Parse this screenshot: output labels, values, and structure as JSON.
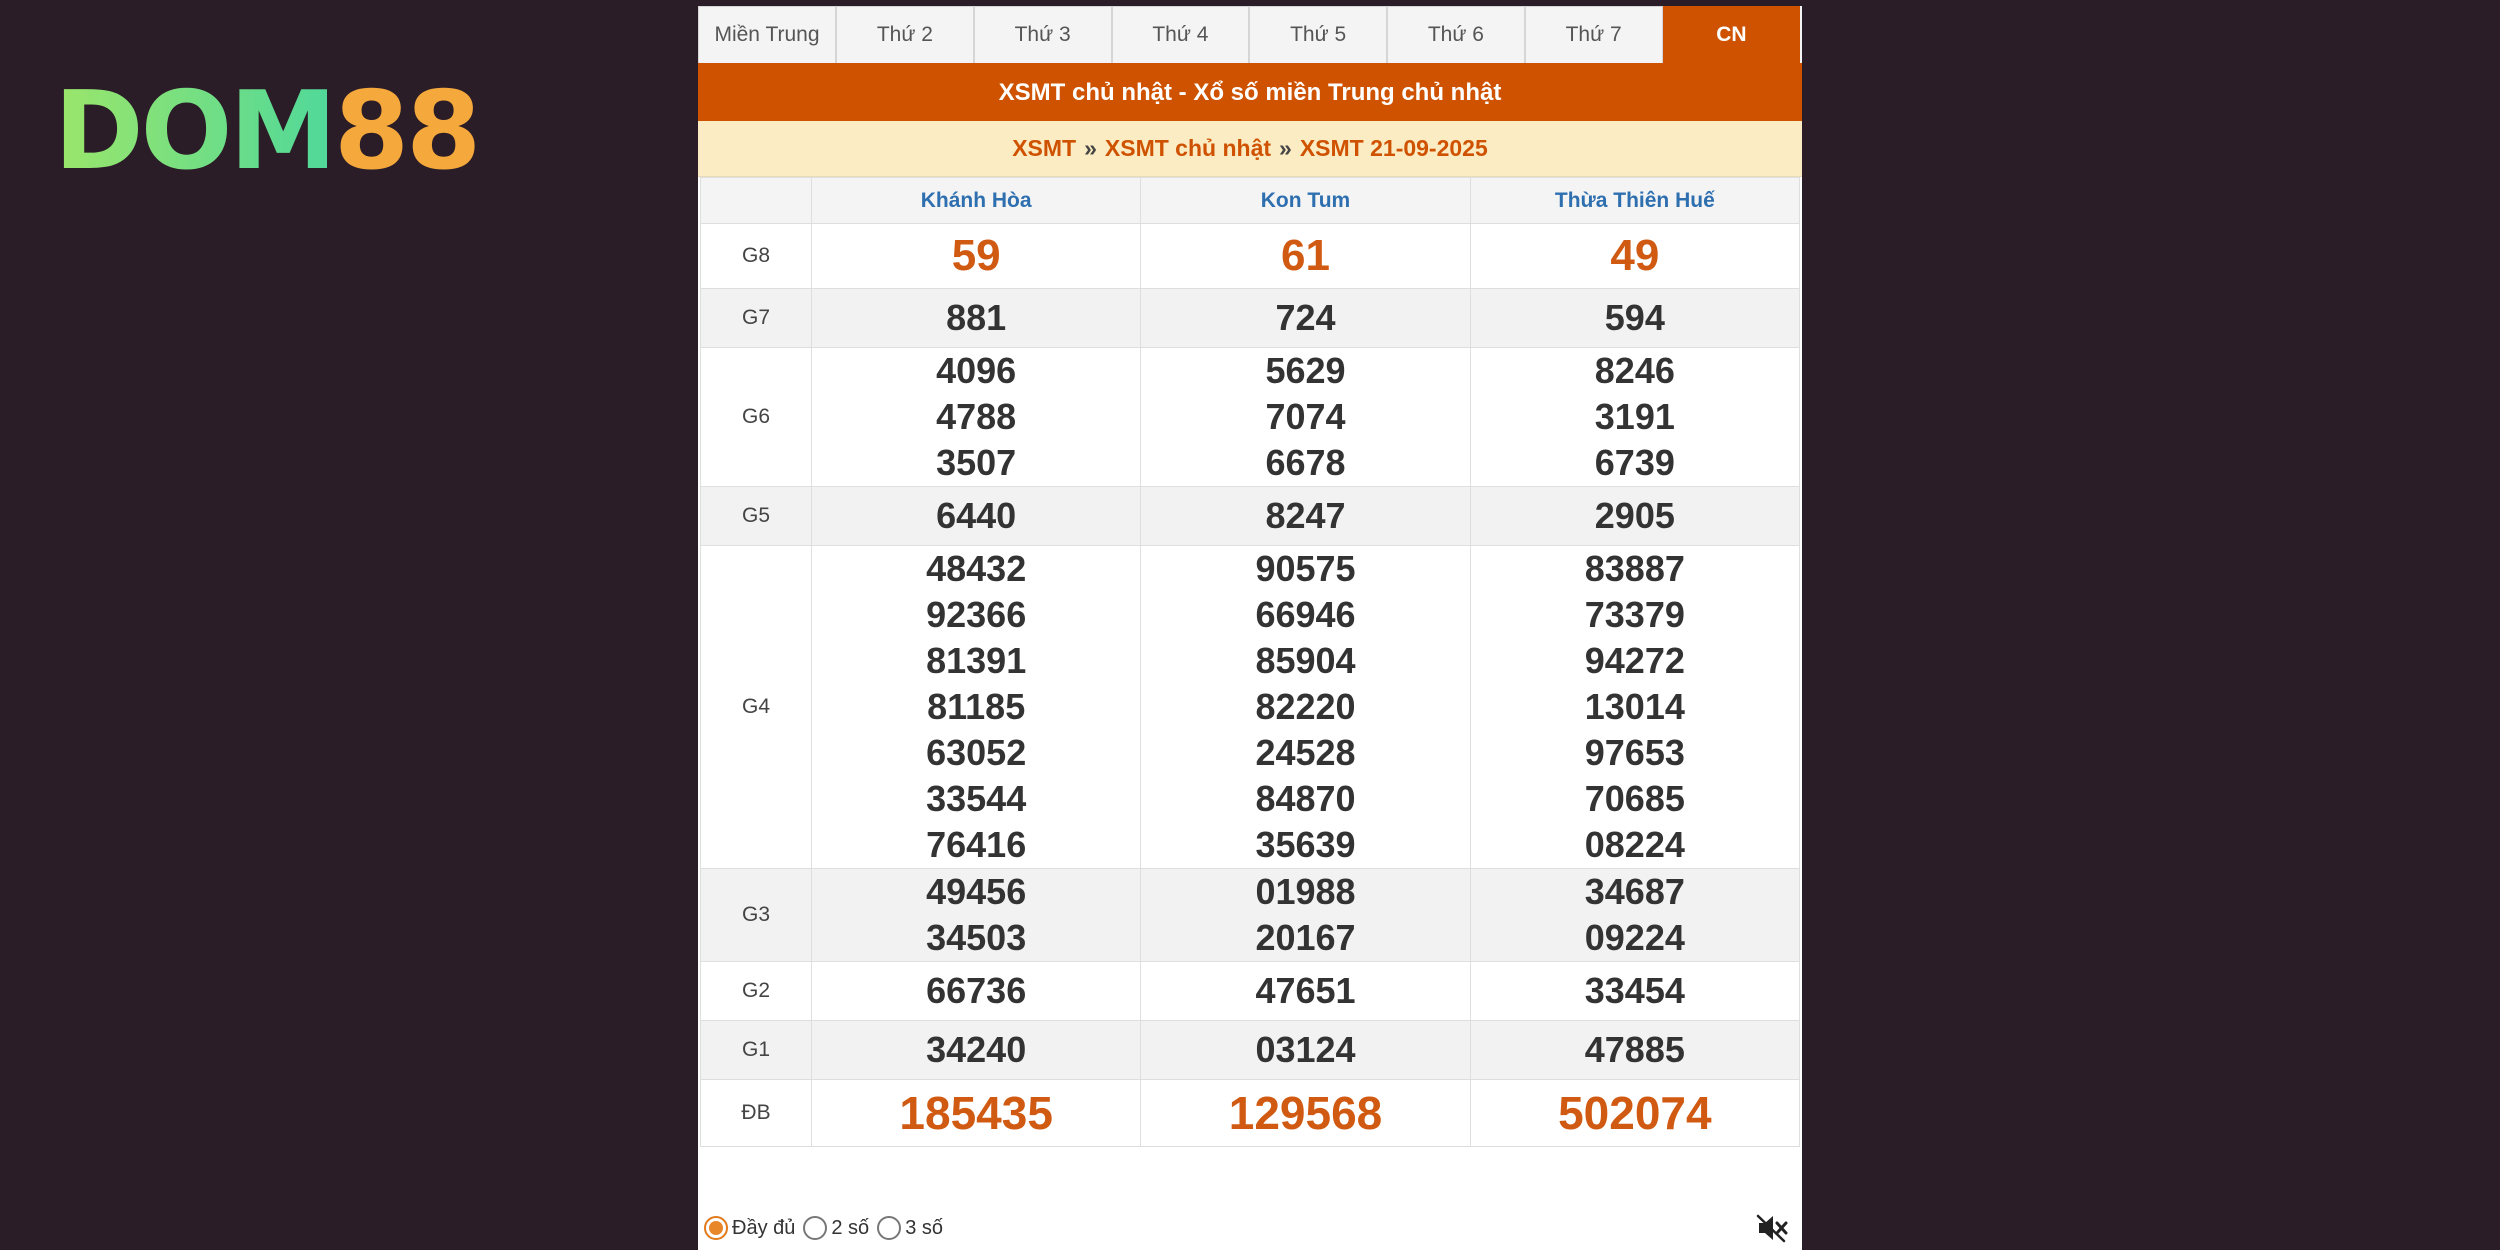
{
  "logo": {
    "part1": "DOM",
    "part2": "88"
  },
  "tabs": [
    "Miền Trung",
    "Thứ 2",
    "Thứ 3",
    "Thứ 4",
    "Thứ 5",
    "Thứ 6",
    "Thứ 7",
    "CN"
  ],
  "active_tab": "CN",
  "title": "XSMT chủ nhật - Xổ số miền Trung chủ nhật",
  "breadcrumb": {
    "b1": "XSMT",
    "sep": "»",
    "b2": "XSMT chủ nhật",
    "b3": "XSMT 21-09-2025"
  },
  "columns": [
    "Khánh Hòa",
    "Kon Tum",
    "Thừa Thiên Huế"
  ],
  "prizes": [
    {
      "label": "G8",
      "values": [
        [
          "59"
        ],
        [
          "61"
        ],
        [
          "49"
        ]
      ]
    },
    {
      "label": "G7",
      "values": [
        [
          "881"
        ],
        [
          "724"
        ],
        [
          "594"
        ]
      ]
    },
    {
      "label": "G6",
      "values": [
        [
          "4096",
          "4788",
          "3507"
        ],
        [
          "5629",
          "7074",
          "6678"
        ],
        [
          "8246",
          "3191",
          "6739"
        ]
      ]
    },
    {
      "label": "G5",
      "values": [
        [
          "6440"
        ],
        [
          "8247"
        ],
        [
          "2905"
        ]
      ]
    },
    {
      "label": "G4",
      "values": [
        [
          "48432",
          "92366",
          "81391",
          "81185",
          "63052",
          "33544",
          "76416"
        ],
        [
          "90575",
          "66946",
          "85904",
          "82220",
          "24528",
          "84870",
          "35639"
        ],
        [
          "83887",
          "73379",
          "94272",
          "13014",
          "97653",
          "70685",
          "08224"
        ]
      ]
    },
    {
      "label": "G3",
      "values": [
        [
          "49456",
          "34503"
        ],
        [
          "01988",
          "20167"
        ],
        [
          "34687",
          "09224"
        ]
      ]
    },
    {
      "label": "G2",
      "values": [
        [
          "66736"
        ],
        [
          "47651"
        ],
        [
          "33454"
        ]
      ]
    },
    {
      "label": "G1",
      "values": [
        [
          "34240"
        ],
        [
          "03124"
        ],
        [
          "47885"
        ]
      ]
    },
    {
      "label": "ĐB",
      "values": [
        [
          "185435"
        ],
        [
          "129568"
        ],
        [
          "502074"
        ]
      ]
    }
  ],
  "footer": {
    "options": [
      "Đầy đủ",
      "2 số",
      "3 số"
    ],
    "selected": "Đầy đủ",
    "sound_icon": "speaker-muted-icon"
  },
  "colors": {
    "accent": "#cf5200",
    "header_blue": "#2e6fb0",
    "highlight": "#d15a12"
  }
}
